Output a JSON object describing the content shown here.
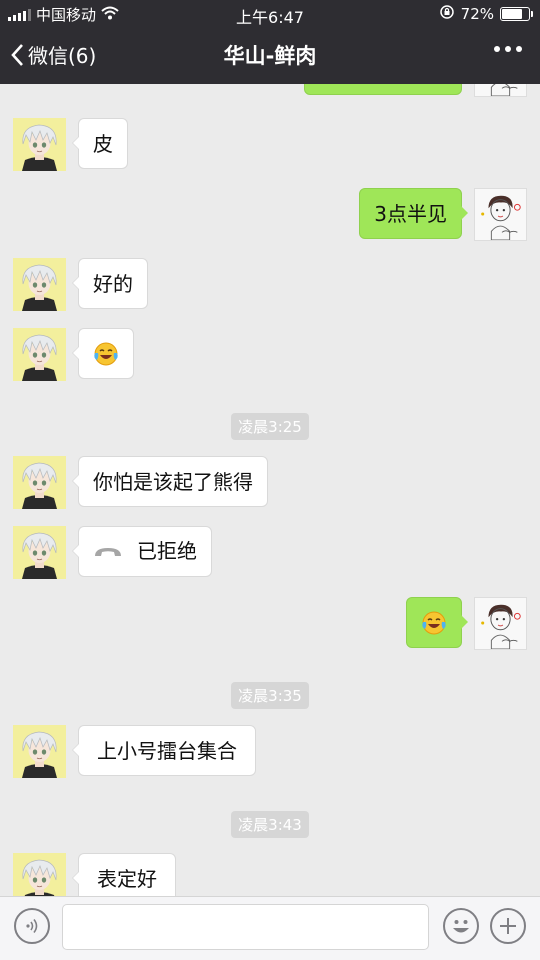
{
  "status_bar": {
    "carrier": "中国移动",
    "time": "上午6:47",
    "battery": "72%",
    "battery_level": 0.72
  },
  "nav": {
    "back_label": "微信(6)",
    "title": "华山-鲜肉"
  },
  "messages": [
    {
      "side": "left",
      "text": "皮"
    },
    {
      "side": "right",
      "text": "3点半见"
    },
    {
      "side": "left",
      "text": "好的"
    },
    {
      "side": "left",
      "emoji": "face-with-tears-of-joy"
    },
    {
      "timestamp": "凌晨3:25"
    },
    {
      "side": "left",
      "text": "你怕是该起了熊得"
    },
    {
      "side": "left",
      "call": "已拒绝"
    },
    {
      "side": "right",
      "emoji": "face-with-tears-of-joy"
    },
    {
      "timestamp": "凌晨3:35"
    },
    {
      "side": "left",
      "text": "上小号擂台集合"
    },
    {
      "timestamp": "凌晨3:43"
    },
    {
      "side": "left",
      "text": "表定好"
    }
  ],
  "colors": {
    "header": "#2e2d32",
    "chat_bg": "#ebebeb",
    "sent_bubble": "#9fe658",
    "received_bubble": "#ffffff",
    "timestamp_bg": "#d6d6d6"
  },
  "icons": {
    "back": "chevron-left-icon",
    "more": "more-dots-icon",
    "voice": "voice-input-icon",
    "emoji": "emoji-icon",
    "add": "plus-icon",
    "call": "phone-declined-icon"
  }
}
